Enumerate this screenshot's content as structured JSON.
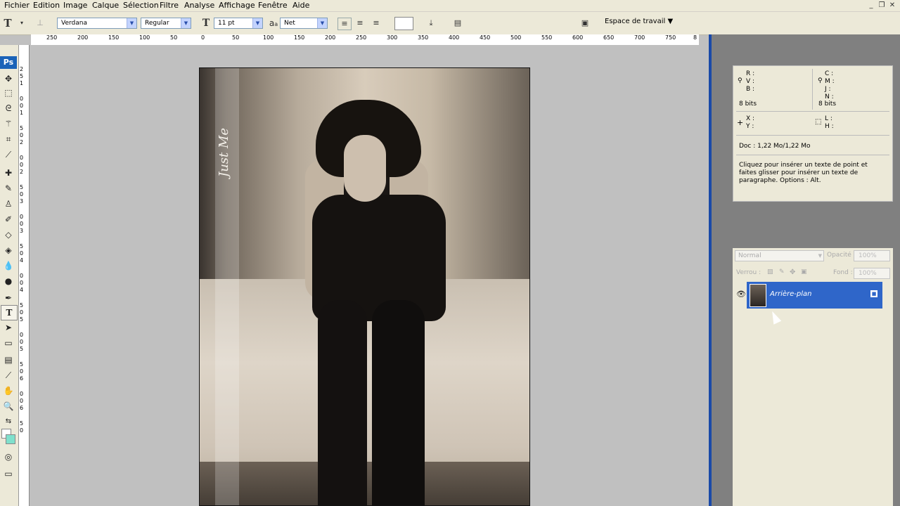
{
  "menu": [
    "Fichier",
    "Edition",
    "Image",
    "Calque",
    "Sélection",
    "Filtre",
    "Analyse",
    "Affichage",
    "Fenêtre",
    "Aide"
  ],
  "window_buttons": [
    "_",
    "❐",
    "✕"
  ],
  "options": {
    "font_family": "Verdana",
    "font_style": "Regular",
    "font_size": "11 pt",
    "antialias": "Net",
    "workspace": "Espace de travail ▼",
    "text_tool_glyph": "T",
    "size_glyph": "T",
    "aa_glyph": "a",
    "aa_glyph_small": "a"
  },
  "ruler_h": [
    "250",
    "200",
    "150",
    "100",
    "50",
    "0",
    "50",
    "100",
    "150",
    "200",
    "250",
    "300",
    "350",
    "400",
    "450",
    "500",
    "550",
    "600",
    "650",
    "700",
    "750",
    "8"
  ],
  "ruler_v": [
    "2",
    "5",
    "1",
    "0",
    "0",
    "1",
    "5",
    "0",
    "2",
    "0",
    "0",
    "2",
    "5",
    "0",
    "3",
    "0",
    "0",
    "3",
    "5",
    "0",
    "4",
    "0",
    "0",
    "4",
    "5",
    "0",
    "5",
    "0",
    "0",
    "5",
    "5",
    "0",
    "6",
    "0",
    "0",
    "6",
    "5",
    "0"
  ],
  "app_logo": "Ps",
  "canvas": {
    "overlay_text": "Just Me"
  },
  "info": {
    "rgb": [
      "R :",
      "V :",
      "B :"
    ],
    "cmyk": [
      "C :",
      "M :",
      "J :",
      "N :"
    ],
    "bits_left": "8 bits",
    "bits_right": "8 bits",
    "xy": [
      "X :",
      "Y :"
    ],
    "lh": [
      "L :",
      "H :"
    ],
    "doc": "Doc : 1,22 Mo/1,22 Mo",
    "hint": "Cliquez pour insérer un texte de point et faites glisser pour insérer un texte de paragraphe. Options : Alt."
  },
  "layers": {
    "blend_mode": "Normal",
    "opacity_label": "Opacité :",
    "opacity_value": "100%",
    "lock_label": "Verrou :",
    "fill_label": "Fond :",
    "fill_value": "100%",
    "layer_name": "Arrière-plan"
  }
}
